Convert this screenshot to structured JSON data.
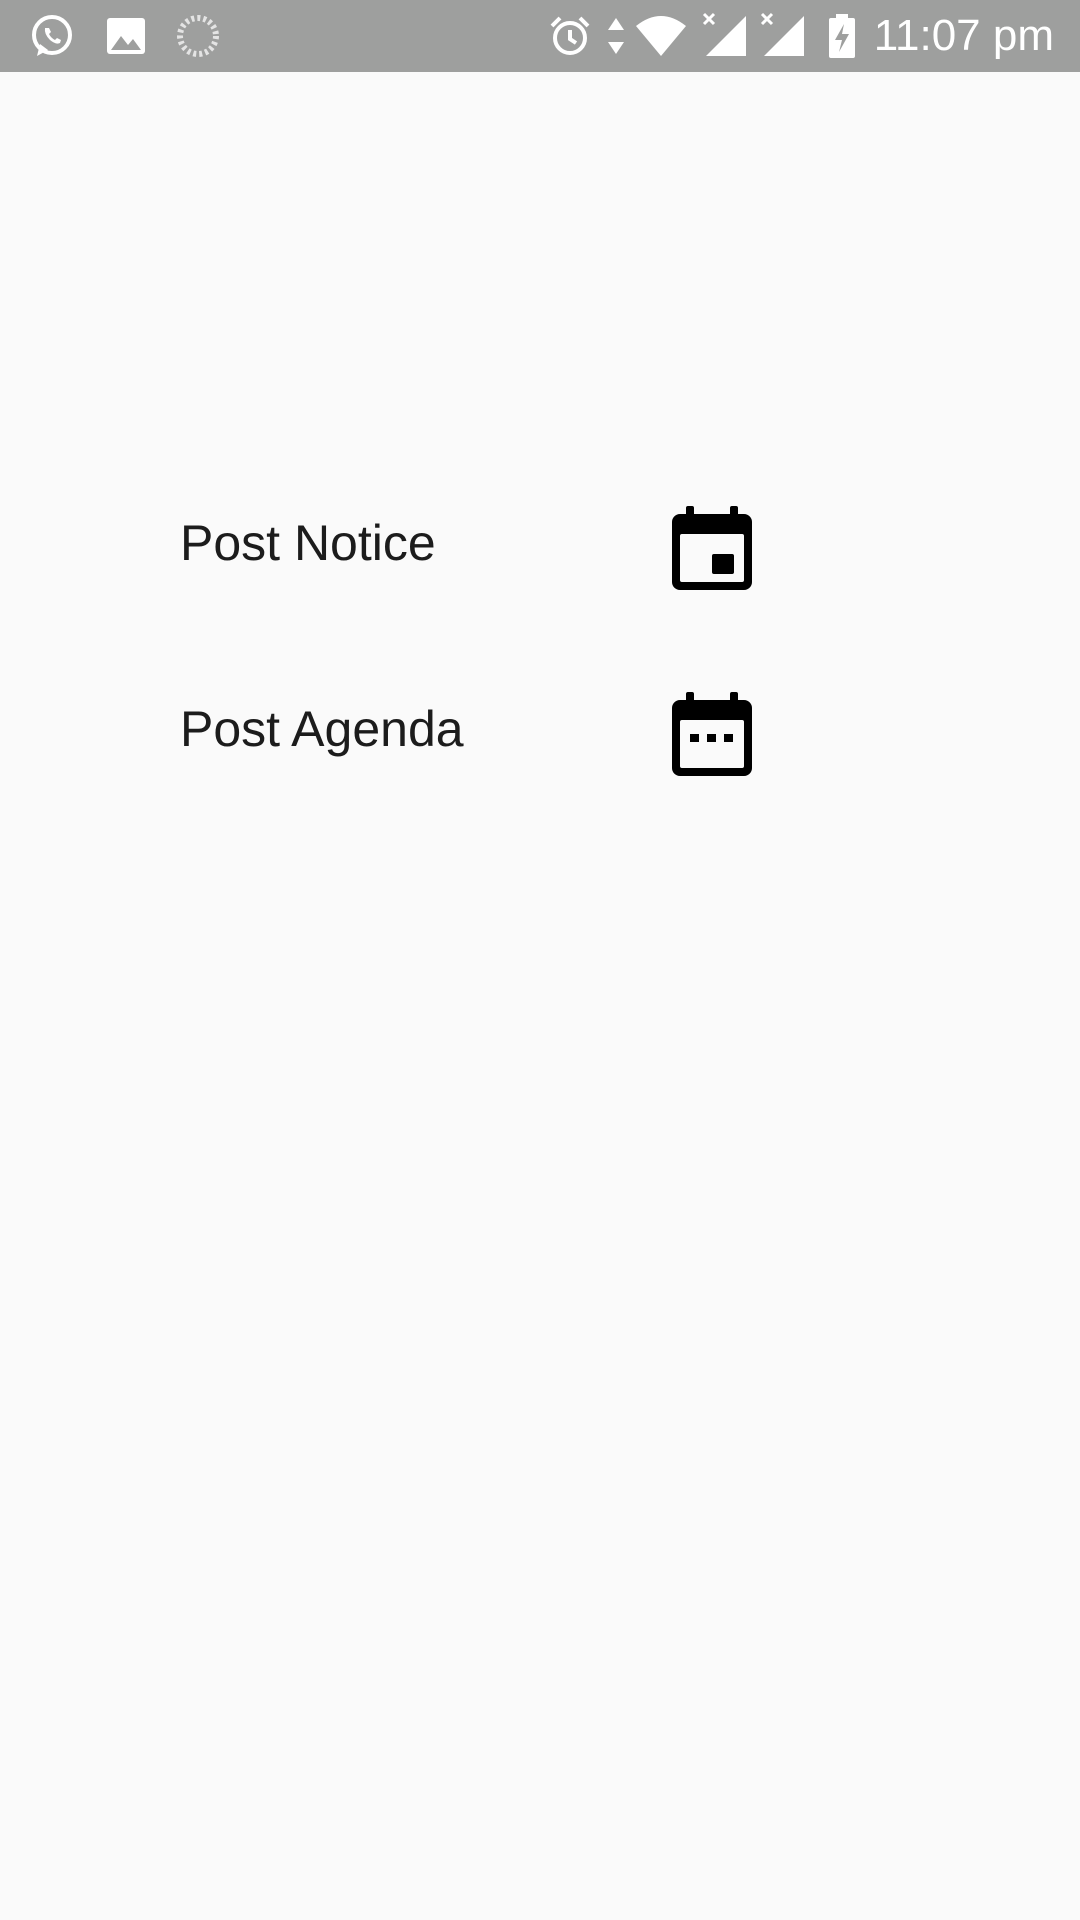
{
  "status_bar": {
    "time": "11:07 pm",
    "background": "#9e9f9e",
    "icons_left": [
      "whatsapp-icon",
      "gallery-icon",
      "loading-spinner-icon"
    ],
    "icons_right": [
      "alarm-icon",
      "data-transfer-icon",
      "wifi-icon",
      "signal-sim1-icon",
      "signal-sim2-icon",
      "battery-charging-icon"
    ]
  },
  "menu": {
    "items": [
      {
        "label": "Post Notice",
        "icon": "calendar-event-icon"
      },
      {
        "label": "Post Agenda",
        "icon": "calendar-dots-icon"
      }
    ]
  }
}
